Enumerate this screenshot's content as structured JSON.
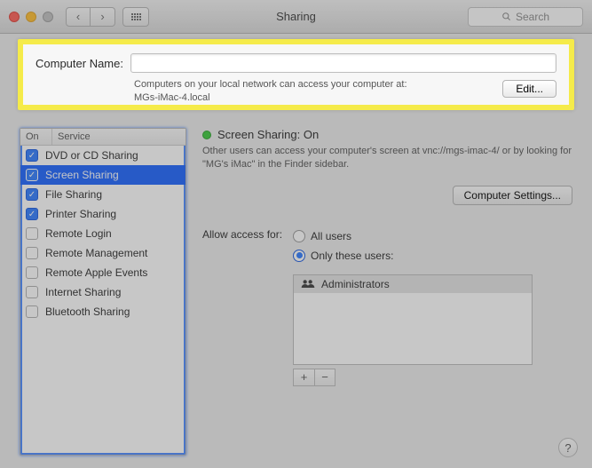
{
  "title": "Sharing",
  "search": {
    "placeholder": "Search"
  },
  "computer_name": {
    "label": "Computer Name:",
    "value": "",
    "help_line1": "Computers on your local network can access your computer at:",
    "help_line2": "MGs-iMac-4.local",
    "edit_label": "Edit..."
  },
  "sidebar": {
    "header_on": "On",
    "header_service": "Service",
    "items": [
      {
        "label": "DVD or CD Sharing",
        "checked": true,
        "selected": false
      },
      {
        "label": "Screen Sharing",
        "checked": true,
        "selected": true
      },
      {
        "label": "File Sharing",
        "checked": true,
        "selected": false
      },
      {
        "label": "Printer Sharing",
        "checked": true,
        "selected": false
      },
      {
        "label": "Remote Login",
        "checked": false,
        "selected": false
      },
      {
        "label": "Remote Management",
        "checked": false,
        "selected": false
      },
      {
        "label": "Remote Apple Events",
        "checked": false,
        "selected": false
      },
      {
        "label": "Internet Sharing",
        "checked": false,
        "selected": false
      },
      {
        "label": "Bluetooth Sharing",
        "checked": false,
        "selected": false
      }
    ]
  },
  "detail": {
    "status_title": "Screen Sharing: On",
    "description": "Other users can access your computer's screen at vnc://mgs-imac-4/ or by looking for \"MG's iMac\" in the Finder sidebar.",
    "computer_settings_label": "Computer Settings...",
    "access_label": "Allow access for:",
    "radio_all": "All users",
    "radio_only": "Only these users:",
    "users": [
      "Administrators"
    ],
    "plus": "+",
    "minus": "−"
  },
  "help": "?",
  "colors": {
    "highlight": "#f5eb4a",
    "accent": "#2f7bff",
    "status_on": "#3bca3b"
  }
}
